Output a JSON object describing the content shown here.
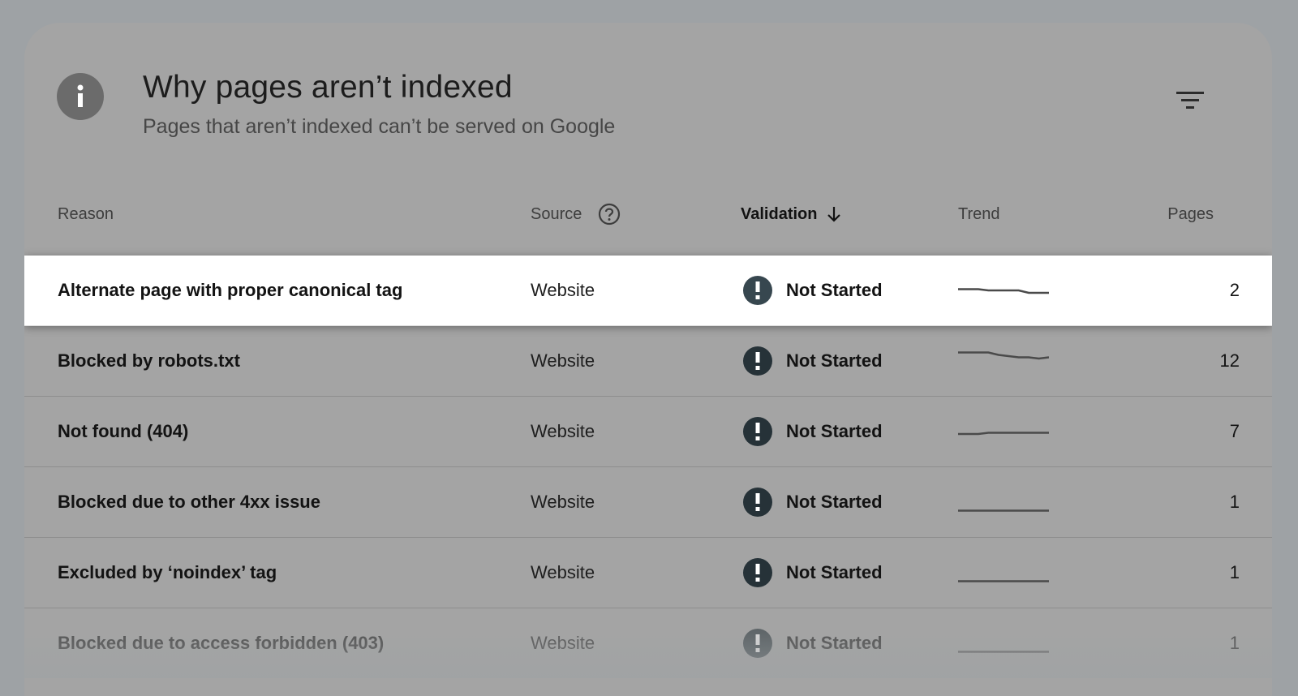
{
  "header": {
    "title": "Why pages aren’t indexed",
    "subtitle": "Pages that aren’t indexed can’t be served on Google"
  },
  "icons": {
    "header": "info-icon",
    "filter": "filter-icon",
    "source_help": "help-icon",
    "sort": "arrow-down-icon",
    "status": "exclamation-circle-icon"
  },
  "columns": {
    "reason": "Reason",
    "source": "Source",
    "validation": "Validation",
    "trend": "Trend",
    "pages": "Pages"
  },
  "rows": [
    {
      "reason": "Alternate page with proper canonical tag",
      "source": "Website",
      "validation": "Not Started",
      "pages": "2",
      "trend": [
        9,
        9,
        9,
        8,
        8,
        8,
        8,
        6,
        6,
        6
      ]
    },
    {
      "reason": "Blocked by robots.txt",
      "source": "Website",
      "validation": "Not Started",
      "pages": "12",
      "trend": [
        15,
        15,
        15,
        15,
        13,
        12,
        11,
        11,
        10,
        11
      ]
    },
    {
      "reason": "Not found (404)",
      "source": "Website",
      "validation": "Not Started",
      "pages": "7",
      "trend": [
        6,
        6,
        6,
        7,
        7,
        7,
        7,
        7,
        7,
        7
      ]
    },
    {
      "reason": "Blocked due to other 4xx issue",
      "source": "Website",
      "validation": "Not Started",
      "pages": "1",
      "trend": [
        1,
        1,
        1,
        1,
        1,
        1,
        1,
        1,
        1,
        1
      ]
    },
    {
      "reason": "Excluded by ‘noindex’ tag",
      "source": "Website",
      "validation": "Not Started",
      "pages": "1",
      "trend": [
        1,
        1,
        1,
        1,
        1,
        1,
        1,
        1,
        1,
        1
      ]
    },
    {
      "reason": "Blocked due to access forbidden (403)",
      "source": "Website",
      "validation": "Not Started",
      "pages": "1",
      "trend": [
        1,
        1,
        1,
        1,
        1,
        1,
        1,
        1,
        1,
        1
      ]
    }
  ],
  "colors": {
    "highlight_row": "#ffffff",
    "status_icon": "#263238",
    "sparkline": "#4a4a4a"
  }
}
